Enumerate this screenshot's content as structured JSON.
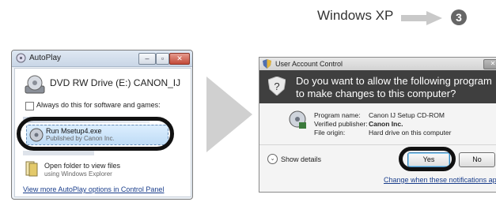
{
  "banner": {
    "label": "Windows XP",
    "step": "3"
  },
  "autoplay": {
    "title": "AutoPlay",
    "drive_title": "DVD RW Drive (E:) CANON_IJ",
    "always_label": "Always do this for software and games:",
    "run_title": "Run Msetup4.exe",
    "run_sub": "Published by Canon Inc.",
    "folder_title": "Open folder to view files",
    "folder_sub": "using Windows Explorer",
    "more_link": "View more AutoPlay options in Control Panel"
  },
  "uac": {
    "title": "User Account Control",
    "question": "Do you want to allow the following program to make changes to this computer?",
    "program_name_key": "Program name:",
    "program_name_val": "Canon IJ Setup CD-ROM",
    "publisher_key": "Verified publisher:",
    "publisher_val": "Canon Inc.",
    "origin_key": "File origin:",
    "origin_val": "Hard drive on this computer",
    "show_details": "Show details",
    "yes_label": "Yes",
    "no_label": "No",
    "notifications_link": "Change when these notifications appear"
  },
  "colors": {
    "uac_header": "#3f3f3f",
    "link": "#1a3e8c",
    "highlight": "#111111"
  },
  "icons": [
    "autoplay-icon",
    "dvd-drive-icon",
    "setup-program-icon",
    "folder-icon",
    "shield-icon",
    "arrow-right-icon",
    "step-number-icon"
  ]
}
